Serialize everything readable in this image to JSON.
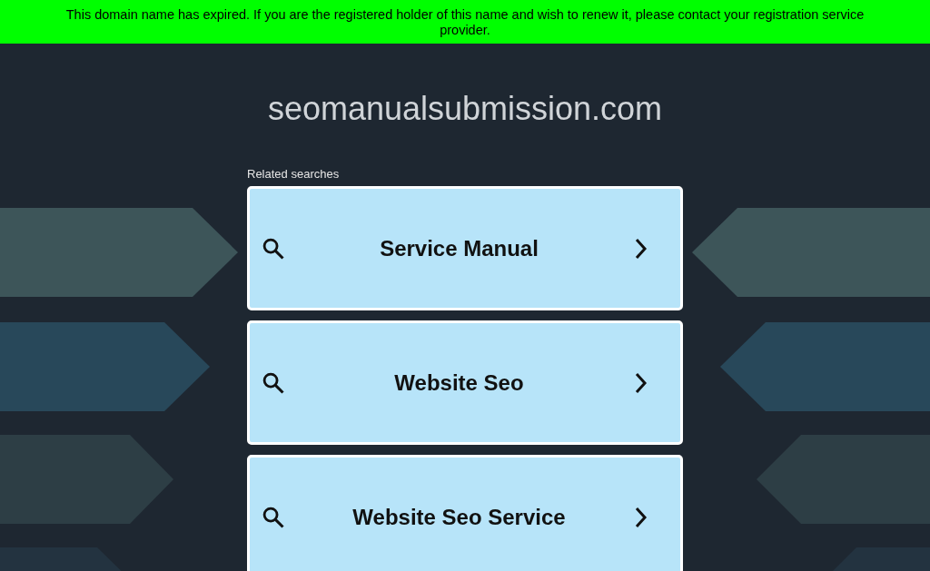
{
  "banner": {
    "text": "This domain name has expired. If you are the registered holder of this name and wish to renew it, please contact your registration service provider."
  },
  "domain": "seomanualsubmission.com",
  "related": {
    "heading": "Related searches",
    "items": [
      {
        "label": "Service Manual"
      },
      {
        "label": "Website Seo"
      },
      {
        "label": "Website Seo Service"
      }
    ]
  }
}
